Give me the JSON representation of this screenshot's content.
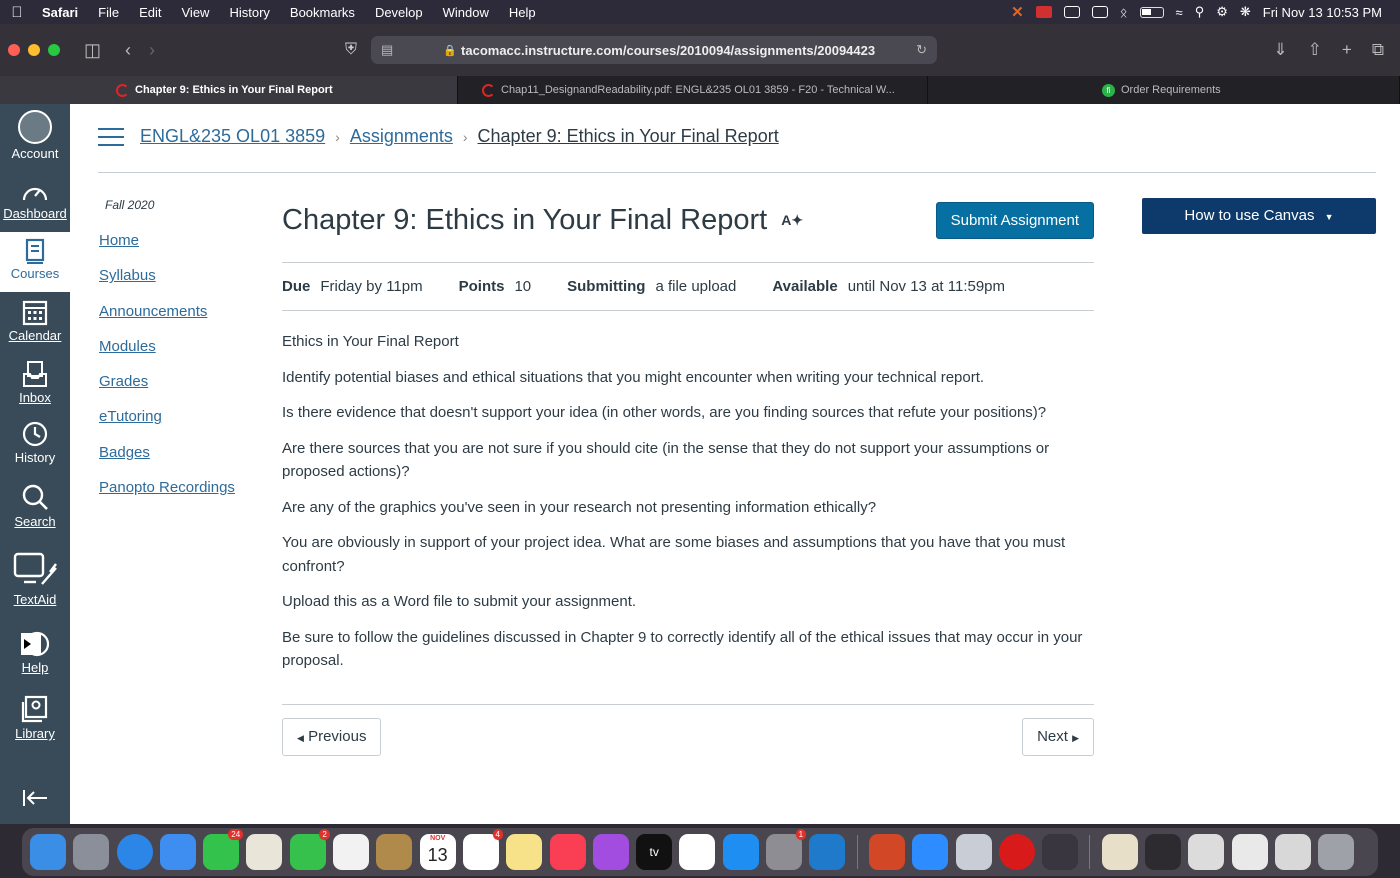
{
  "menubar": {
    "app": "Safari",
    "items": [
      "File",
      "Edit",
      "View",
      "History",
      "Bookmarks",
      "Develop",
      "Window",
      "Help"
    ],
    "clock": "Fri Nov 13  10:53 PM"
  },
  "browser": {
    "url": "tacomacc.instructure.com/courses/2010094/assignments/20094423",
    "tabs": [
      {
        "label": "Chapter 9: Ethics in Your Final Report"
      },
      {
        "label": "Chap11_DesignandReadability.pdf: ENGL&235 OL01 3859 - F20 - Technical W..."
      },
      {
        "label": "Order Requirements"
      }
    ]
  },
  "globalnav": {
    "account": "Account",
    "dashboard": "Dashboard",
    "courses": "Courses",
    "calendar": "Calendar",
    "inbox": "Inbox",
    "history": "History",
    "search": "Search",
    "textaid": "TextAid",
    "help": "Help",
    "library": "Library"
  },
  "breadcrumb": {
    "course": "ENGL&235 OL01 3859",
    "section": "Assignments",
    "page": "Chapter 9: Ethics in Your Final Report"
  },
  "coursenav": {
    "term": "Fall 2020",
    "links": [
      "Home",
      "Syllabus",
      "Announcements",
      "Modules",
      "Grades",
      "eTutoring",
      "Badges",
      "Panopto Recordings"
    ]
  },
  "assignment": {
    "title": "Chapter 9: Ethics in Your Final Report",
    "submit_label": "Submit Assignment",
    "due_label": "Due",
    "due_value": "Friday by 11pm",
    "points_label": "Points",
    "points_value": "10",
    "submitting_label": "Submitting",
    "submitting_value": "a file upload",
    "available_label": "Available",
    "available_value": "until Nov 13 at 11:59pm",
    "body": [
      "Ethics in Your Final Report",
      "Identify potential biases and ethical situations that you might encounter when writing your technical report.",
      "Is there evidence that doesn't support your idea (in other words, are you finding sources that refute your positions)?",
      "Are there sources that you are not sure if you should cite (in the sense that they do not support your assumptions or proposed actions)?",
      "Are any of the graphics you've seen in your research not presenting information ethically?",
      "You are obviously in support of your project idea. What are some biases and assumptions that you have that you must confront?",
      "Upload this as a Word file to submit your assignment.",
      "Be sure to follow the guidelines discussed in Chapter 9 to correctly identify all of the ethical issues that may occur in your proposal."
    ],
    "previous_label": "Previous",
    "next_label": "Next"
  },
  "sidebar": {
    "howto_label": "How to use Canvas"
  },
  "dock": {
    "calendar_month": "NOV",
    "calendar_day": "13",
    "messages_badge": "24",
    "facetime_badge": "2",
    "reminders_badge": "4",
    "settings_badge": "1",
    "tv_label": "tv"
  },
  "colors": {
    "canvas_nav": "#394b58",
    "link": "#2d6b9a",
    "submit_button": "#0770a3",
    "howto_button": "#0e3a6b"
  }
}
